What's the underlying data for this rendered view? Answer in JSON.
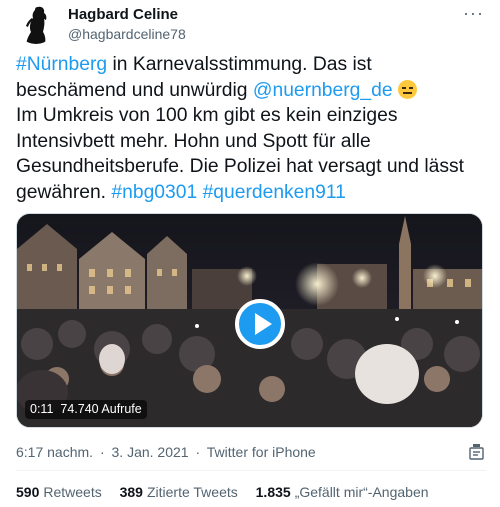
{
  "author": {
    "display_name": "Hagbard Celine",
    "handle": "@hagbardceline78",
    "avatar_icon": "hooded-figure-silhouette"
  },
  "more_icon": "ellipsis-icon",
  "tweet": {
    "hashtag_nuernberg": "#Nürnberg",
    "text_1": " in Karnevalsstimmung. Das ist beschämend und unwürdig ",
    "mention": "@nuernberg_de",
    "emoji": "expressionless-face",
    "text_2": "Im Umkreis von 100 km gibt es kein einziges Intensivbett mehr. Hohn und Spott für alle Gesundheitsberufe. Die Polizei hat versagt und lässt gewähren. ",
    "hashtag_nbg": "#nbg0301",
    "hashtag_querdenken": "#querdenken911"
  },
  "video": {
    "duration": "0:11",
    "views": "74.740 Aufrufe",
    "play_icon": "play-icon"
  },
  "meta": {
    "time": "6:17 nachm.",
    "separator": "·",
    "date": "3. Jan. 2021",
    "source": "Twitter for iPhone"
  },
  "stats": {
    "retweets_count": "590",
    "retweets_label": "Retweets",
    "quotes_count": "389",
    "quotes_label": "Zitierte Tweets",
    "likes_count": "1.835",
    "likes_label": "„Gefällt mir“-Angaben"
  },
  "colors": {
    "link": "#1d9bf0",
    "text": "#0f1419",
    "secondary": "#536471"
  }
}
